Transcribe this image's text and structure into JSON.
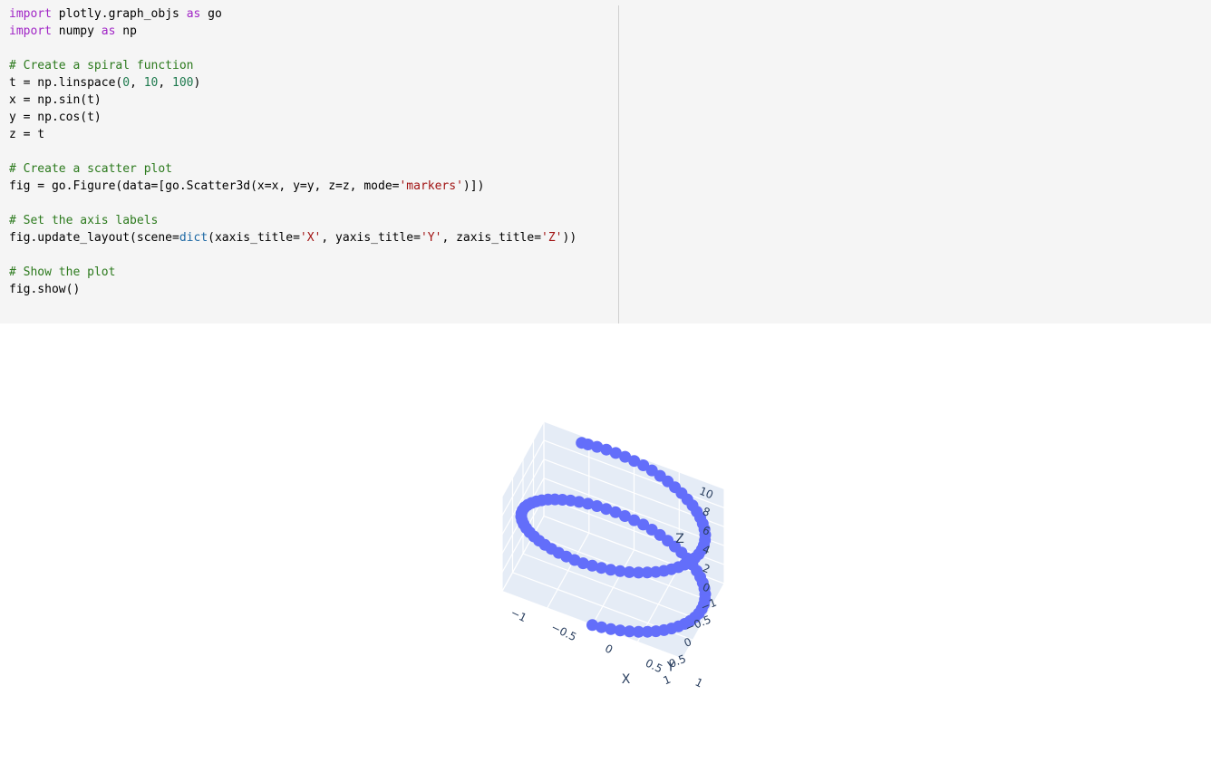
{
  "code": [
    [
      {
        "t": "import",
        "c": "kw"
      },
      {
        "t": " plotly.graph_objs "
      },
      {
        "t": "as",
        "c": "kw"
      },
      {
        "t": " go"
      }
    ],
    [
      {
        "t": "import",
        "c": "kw"
      },
      {
        "t": " numpy "
      },
      {
        "t": "as",
        "c": "kw"
      },
      {
        "t": " np"
      }
    ],
    [],
    [
      {
        "t": "# Create a spiral function",
        "c": "comment"
      }
    ],
    [
      {
        "t": "t = np.linspace("
      },
      {
        "t": "0",
        "c": "num"
      },
      {
        "t": ", "
      },
      {
        "t": "10",
        "c": "num"
      },
      {
        "t": ", "
      },
      {
        "t": "100",
        "c": "num"
      },
      {
        "t": ")"
      }
    ],
    [
      {
        "t": "x = np.sin(t)"
      }
    ],
    [
      {
        "t": "y = np.cos(t)"
      }
    ],
    [
      {
        "t": "z = t"
      }
    ],
    [],
    [
      {
        "t": "# Create a scatter plot",
        "c": "comment"
      }
    ],
    [
      {
        "t": "fig = go.Figure(data=[go.Scatter3d(x=x, y=y, z=z, mode="
      },
      {
        "t": "'markers'",
        "c": "str"
      },
      {
        "t": ")])"
      }
    ],
    [],
    [
      {
        "t": "# Set the axis labels",
        "c": "comment"
      }
    ],
    [
      {
        "t": "fig.update_layout(scene="
      },
      {
        "t": "dict",
        "c": "builtin"
      },
      {
        "t": "(xaxis_title="
      },
      {
        "t": "'X'",
        "c": "str"
      },
      {
        "t": ", yaxis_title="
      },
      {
        "t": "'Y'",
        "c": "str"
      },
      {
        "t": ", zaxis_title="
      },
      {
        "t": "'Z'",
        "c": "str"
      },
      {
        "t": "))"
      }
    ],
    [],
    [
      {
        "t": "# Show the plot",
        "c": "comment"
      }
    ],
    [
      {
        "t": "fig.show()"
      }
    ]
  ],
  "chart_data": {
    "type": "scatter3d",
    "mode": "markers",
    "marker_color": "#636efa",
    "scene_bgcolor": "#e5ecf6",
    "grid": true,
    "x": [
      0.0,
      0.1008,
      0.2006,
      0.2983,
      0.3931,
      0.4838,
      0.5696,
      0.6496,
      0.7229,
      0.7888,
      0.8467,
      0.8958,
      0.9357,
      0.966,
      0.9864,
      0.9967,
      0.9967,
      0.9865,
      0.9662,
      0.936,
      0.8962,
      0.8472,
      0.7894,
      0.7235,
      0.6502,
      0.5703,
      0.4845,
      0.3938,
      0.299,
      0.2013,
      0.1015,
      0.0007,
      -0.1001,
      -0.1999,
      -0.2977,
      -0.3925,
      -0.4832,
      -0.569,
      -0.649,
      -0.7223,
      -0.7882,
      -0.8462,
      -0.8954,
      -0.9354,
      -0.9658,
      -0.9863,
      -0.9966,
      -0.9968,
      -0.9866,
      -0.9664,
      -0.9362,
      -0.8965,
      -0.8476,
      -0.7899,
      -0.7241,
      -0.6509,
      -0.5709,
      -0.4852,
      -0.3944,
      -0.2997,
      -0.202,
      -0.1022,
      -0.0014,
      0.0994,
      0.1992,
      0.297,
      0.3918,
      0.4826,
      0.5684,
      0.6484,
      0.7218,
      0.7877,
      0.8457,
      0.895,
      0.9351,
      0.9655,
      0.9861,
      0.9966,
      0.9968,
      0.9867,
      0.9666,
      0.9365,
      0.8969,
      0.8481,
      0.7905,
      0.7247,
      0.6515,
      0.5716,
      0.4858,
      0.3951,
      0.3004,
      0.2027,
      0.1029,
      0.0021,
      -0.0987,
      -0.1986,
      -0.2964,
      -0.3912,
      -0.482,
      -0.544
    ],
    "y": [
      1.0,
      0.9949,
      0.9797,
      0.9545,
      0.9195,
      0.8752,
      0.8219,
      0.7603,
      0.6909,
      0.6146,
      0.5321,
      0.4444,
      0.3526,
      0.2577,
      0.1606,
      0.0625,
      -0.0355,
      -0.1338,
      -0.2311,
      -0.3264,
      -0.4187,
      -0.5071,
      -0.5907,
      -0.6687,
      -0.7403,
      -0.8048,
      -0.8615,
      -0.9099,
      -0.9495,
      -0.9798,
      -1.0,
      -1.0,
      -0.9949,
      -0.9798,
      -0.9546,
      -0.9197,
      -0.8754,
      -0.8222,
      -0.7607,
      -0.6913,
      -0.6151,
      -0.5327,
      -0.445,
      -0.3533,
      -0.2584,
      -0.1613,
      -0.0632,
      0.0348,
      0.1331,
      0.2304,
      0.3258,
      0.4181,
      0.5065,
      0.5902,
      0.6682,
      0.7398,
      0.8044,
      0.8612,
      0.9096,
      0.9493,
      0.9796,
      0.9999,
      1.0,
      0.995,
      0.9799,
      0.9548,
      0.92,
      0.8758,
      0.8226,
      0.7612,
      0.6919,
      0.6158,
      0.5334,
      0.4457,
      0.354,
      0.2591,
      0.162,
      0.0639,
      -0.0341,
      -0.1324,
      -0.2297,
      -0.3251,
      -0.4174,
      -0.5059,
      -0.5896,
      -0.6676,
      -0.7393,
      -0.8039,
      -0.8608,
      -0.9093,
      -0.9491,
      -0.9795,
      -0.9999,
      -1.0,
      -0.9951,
      -0.9801,
      -0.955,
      -0.9202,
      -0.8762,
      -0.8391
    ],
    "z_range": [
      0,
      10
    ],
    "z_count": 100,
    "xaxis": {
      "title": "X",
      "range": [
        -1,
        1
      ],
      "ticks": [
        "−1",
        "−0.5",
        "0",
        "0.5",
        "1"
      ]
    },
    "yaxis": {
      "title": "Y",
      "range": [
        -1,
        1
      ],
      "ticks": [
        "−1",
        "−0.5",
        "0",
        "0.5",
        "1"
      ]
    },
    "zaxis": {
      "title": "Z",
      "range": [
        0,
        10
      ],
      "ticks": [
        "0",
        "2",
        "4",
        "6",
        "8",
        "10"
      ]
    }
  }
}
